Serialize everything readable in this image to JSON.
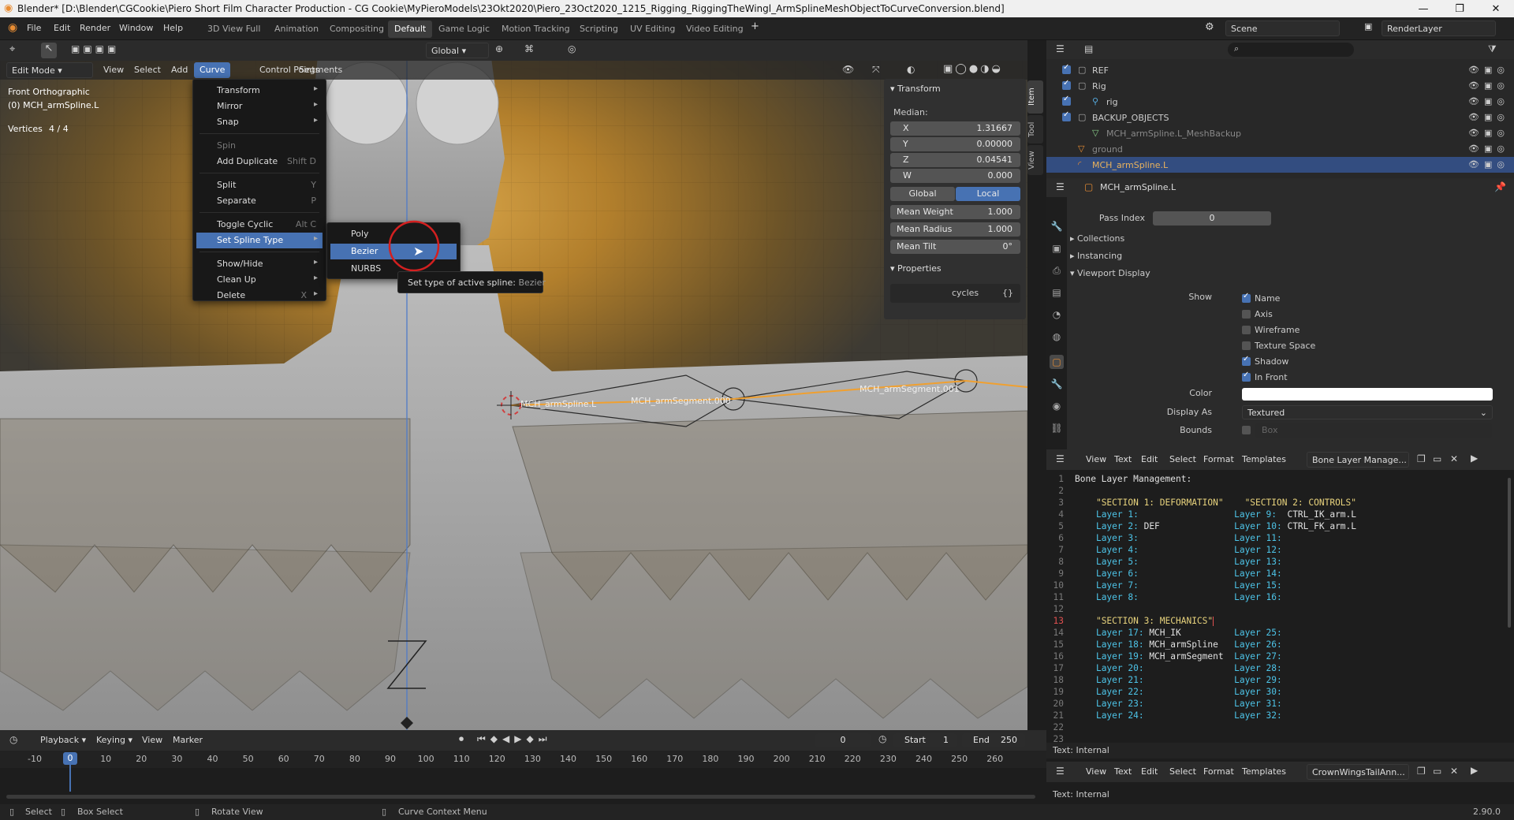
{
  "title_bar": {
    "text": "Blender* [D:\\Blender\\CGCookie\\Piero Short Film Character Production - CG Cookie\\MyPieroModels\\23Okt2020\\Piero_23Oct2020_1215_Rigging_RiggingTheWingl_ArmSplineMeshObjectToCurveConversion.blend]"
  },
  "menubar": {
    "items": [
      "File",
      "Edit",
      "Render",
      "Window",
      "Help"
    ],
    "workspaces": [
      "3D View Full",
      "Animation",
      "Compositing",
      "Default",
      "Game Logic",
      "Motion Tracking",
      "Scripting",
      "UV Editing",
      "Video Editing"
    ],
    "active_workspace": "Default",
    "scene": "Scene",
    "render_layer": "RenderLayer"
  },
  "viewport": {
    "mode": "Edit Mode",
    "header_menus": [
      "View",
      "Select",
      "Add",
      "Curve",
      "Control Points",
      "Segments"
    ],
    "active_menu": "Curve",
    "orientation": "Global",
    "overlay_text": {
      "view": "Front Orthographic",
      "object": "(0) MCH_armSpline.L",
      "vertices_label": "Vertices",
      "vertices_value": "4 / 4"
    },
    "labels": [
      "MCH_armSpline.L",
      "MCH_armSegment.000",
      "MCH_armSegment.001"
    ]
  },
  "curve_menu": {
    "items": [
      {
        "label": "Transform",
        "shortcut": "",
        "submenu": true
      },
      {
        "label": "Mirror",
        "shortcut": "",
        "submenu": true
      },
      {
        "label": "Snap",
        "shortcut": "",
        "submenu": true
      },
      {
        "label": "Spin",
        "shortcut": "",
        "submenu": false,
        "disabled": true
      },
      {
        "label": "Add Duplicate",
        "shortcut": "Shift D",
        "submenu": false
      },
      {
        "label": "Split",
        "shortcut": "Y",
        "submenu": false
      },
      {
        "label": "Separate",
        "shortcut": "P",
        "submenu": false
      },
      {
        "label": "Toggle Cyclic",
        "shortcut": "Alt C",
        "submenu": false
      },
      {
        "label": "Set Spline Type",
        "shortcut": "",
        "submenu": true
      },
      {
        "label": "Show/Hide",
        "shortcut": "",
        "submenu": true
      },
      {
        "label": "Clean Up",
        "shortcut": "",
        "submenu": true
      },
      {
        "label": "Delete",
        "shortcut": "X",
        "submenu": true
      }
    ]
  },
  "spline_submenu": {
    "items": [
      "Poly",
      "Bezier",
      "NURBS"
    ],
    "highlighted": "Bezier"
  },
  "tooltip": {
    "text": "Set type of active spline:",
    "value": "Bezier"
  },
  "npanel": {
    "tabs": [
      "Item",
      "Tool",
      "View"
    ],
    "transform_title": "Transform",
    "median_label": "Median:",
    "fields": [
      {
        "label": "X",
        "value": "1.31667"
      },
      {
        "label": "Y",
        "value": "0.00000"
      },
      {
        "label": "Z",
        "value": "0.04541"
      },
      {
        "label": "W",
        "value": "0.000"
      }
    ],
    "space_buttons": [
      "Global",
      "Local"
    ],
    "active_space": "Local",
    "extra": [
      {
        "label": "Mean Weight",
        "value": "1.000"
      },
      {
        "label": "Mean Radius",
        "value": "1.000"
      },
      {
        "label": "Mean Tilt",
        "value": "0°"
      }
    ],
    "properties_title": "Properties",
    "cycles_label": "cycles",
    "cycles_value": "{}"
  },
  "outliner": {
    "rows": [
      {
        "name": "REF",
        "selected": false
      },
      {
        "name": "Rig",
        "selected": false
      },
      {
        "name": "rig",
        "selected": false
      },
      {
        "name": "BACKUP_OBJECTS",
        "selected": false
      },
      {
        "name": "MCH_armSpline.L_MeshBackup",
        "selected": false
      },
      {
        "name": "ground",
        "selected": false
      },
      {
        "name": "MCH_armSpline.L",
        "selected": true
      }
    ]
  },
  "properties": {
    "object_name": "MCH_armSpline.L",
    "pass_index_label": "Pass Index",
    "pass_index_value": "0",
    "sections": [
      "Collections",
      "Instancing",
      "Viewport Display"
    ],
    "show_label": "Show",
    "show_options": [
      {
        "label": "Name",
        "checked": true
      },
      {
        "label": "Axis",
        "checked": false
      },
      {
        "label": "Wireframe",
        "checked": false
      },
      {
        "label": "Texture Space",
        "checked": false
      },
      {
        "label": "Shadow",
        "checked": true
      },
      {
        "label": "In Front",
        "checked": true
      }
    ],
    "color_label": "Color",
    "display_as_label": "Display As",
    "display_as_value": "Textured",
    "bounds_label": "Bounds",
    "bounds_value": "Box"
  },
  "text_editor": {
    "menus": [
      "View",
      "Text",
      "Edit",
      "Select",
      "Format",
      "Templates"
    ],
    "file_name": "Bone Layer Manage...",
    "lines": [
      {
        "n": "1",
        "t": [
          [
            "txt",
            "Bone Layer Management:"
          ]
        ]
      },
      {
        "n": "2",
        "t": []
      },
      {
        "n": "3",
        "t": [
          [
            "txt",
            "    "
          ],
          [
            "str",
            "\"SECTION 1: DEFORMATION\""
          ],
          [
            "txt",
            "    "
          ],
          [
            "str",
            "\"SECTION 2: CONTROLS\""
          ]
        ]
      },
      {
        "n": "4",
        "t": [
          [
            "txt",
            "    "
          ],
          [
            "num",
            "Layer 1:"
          ],
          [
            "txt",
            "                  "
          ],
          [
            "num",
            "Layer 9:"
          ],
          [
            "txt",
            "  CTRL_IK_arm.L"
          ]
        ]
      },
      {
        "n": "5",
        "t": [
          [
            "txt",
            "    "
          ],
          [
            "num",
            "Layer 2:"
          ],
          [
            "txt",
            " DEF              "
          ],
          [
            "num",
            "Layer 10:"
          ],
          [
            "txt",
            " CTRL_FK_arm.L"
          ]
        ]
      },
      {
        "n": "6",
        "t": [
          [
            "txt",
            "    "
          ],
          [
            "num",
            "Layer 3:"
          ],
          [
            "txt",
            "                  "
          ],
          [
            "num",
            "Layer 11:"
          ]
        ]
      },
      {
        "n": "7",
        "t": [
          [
            "txt",
            "    "
          ],
          [
            "num",
            "Layer 4:"
          ],
          [
            "txt",
            "                  "
          ],
          [
            "num",
            "Layer 12:"
          ]
        ]
      },
      {
        "n": "8",
        "t": [
          [
            "txt",
            "    "
          ],
          [
            "num",
            "Layer 5:"
          ],
          [
            "txt",
            "                  "
          ],
          [
            "num",
            "Layer 13:"
          ]
        ]
      },
      {
        "n": "9",
        "t": [
          [
            "txt",
            "    "
          ],
          [
            "num",
            "Layer 6:"
          ],
          [
            "txt",
            "                  "
          ],
          [
            "num",
            "Layer 14:"
          ]
        ]
      },
      {
        "n": "10",
        "t": [
          [
            "txt",
            "    "
          ],
          [
            "num",
            "Layer 7:"
          ],
          [
            "txt",
            "                  "
          ],
          [
            "num",
            "Layer 15:"
          ]
        ]
      },
      {
        "n": "11",
        "t": [
          [
            "txt",
            "    "
          ],
          [
            "num",
            "Layer 8:"
          ],
          [
            "txt",
            "                  "
          ],
          [
            "num",
            "Layer 16:"
          ]
        ]
      },
      {
        "n": "12",
        "t": []
      },
      {
        "n": "13",
        "cur": true,
        "t": [
          [
            "txt",
            "    "
          ],
          [
            "str",
            "\"SECTION 3: MECHANICS\""
          ]
        ]
      },
      {
        "n": "14",
        "t": [
          [
            "txt",
            "    "
          ],
          [
            "num",
            "Layer 17:"
          ],
          [
            "txt",
            " MCH_IK          "
          ],
          [
            "num",
            "Layer 25:"
          ]
        ]
      },
      {
        "n": "15",
        "t": [
          [
            "txt",
            "    "
          ],
          [
            "num",
            "Layer 18:"
          ],
          [
            "txt",
            " MCH_armSpline   "
          ],
          [
            "num",
            "Layer 26:"
          ]
        ]
      },
      {
        "n": "16",
        "t": [
          [
            "txt",
            "    "
          ],
          [
            "num",
            "Layer 19:"
          ],
          [
            "txt",
            " MCH_armSegment  "
          ],
          [
            "num",
            "Layer 27:"
          ]
        ]
      },
      {
        "n": "17",
        "t": [
          [
            "txt",
            "    "
          ],
          [
            "num",
            "Layer 20:"
          ],
          [
            "txt",
            "                 "
          ],
          [
            "num",
            "Layer 28:"
          ]
        ]
      },
      {
        "n": "18",
        "t": [
          [
            "txt",
            "    "
          ],
          [
            "num",
            "Layer 21:"
          ],
          [
            "txt",
            "                 "
          ],
          [
            "num",
            "Layer 29:"
          ]
        ]
      },
      {
        "n": "19",
        "t": [
          [
            "txt",
            "    "
          ],
          [
            "num",
            "Layer 22:"
          ],
          [
            "txt",
            "                 "
          ],
          [
            "num",
            "Layer 30:"
          ]
        ]
      },
      {
        "n": "20",
        "t": [
          [
            "txt",
            "    "
          ],
          [
            "num",
            "Layer 23:"
          ],
          [
            "txt",
            "                 "
          ],
          [
            "num",
            "Layer 31:"
          ]
        ]
      },
      {
        "n": "21",
        "t": [
          [
            "txt",
            "    "
          ],
          [
            "num",
            "Layer 24:"
          ],
          [
            "txt",
            "                 "
          ],
          [
            "num",
            "Layer 32:"
          ]
        ]
      },
      {
        "n": "22",
        "t": []
      },
      {
        "n": "23",
        "t": []
      }
    ],
    "status": "Text: Internal",
    "second_file_name": "CrownWingsTailAnn...",
    "second_status": "Text: Internal"
  },
  "timeline": {
    "menus": [
      "Playback",
      "Keying",
      "View",
      "Marker"
    ],
    "current_frame": "0",
    "start_label": "Start",
    "start_value": "1",
    "end_label": "End",
    "end_value": "250",
    "ticks": [
      "-10",
      "0",
      "10",
      "20",
      "30",
      "40",
      "50",
      "60",
      "70",
      "80",
      "90",
      "100",
      "110",
      "120",
      "130",
      "140",
      "150",
      "160",
      "170",
      "180",
      "190",
      "200",
      "210",
      "220",
      "230",
      "240",
      "250",
      "260"
    ]
  },
  "statusbar": {
    "items": [
      "Select",
      "Box Select",
      "Rotate View",
      "Curve Context Menu"
    ],
    "version": "2.90.0"
  }
}
